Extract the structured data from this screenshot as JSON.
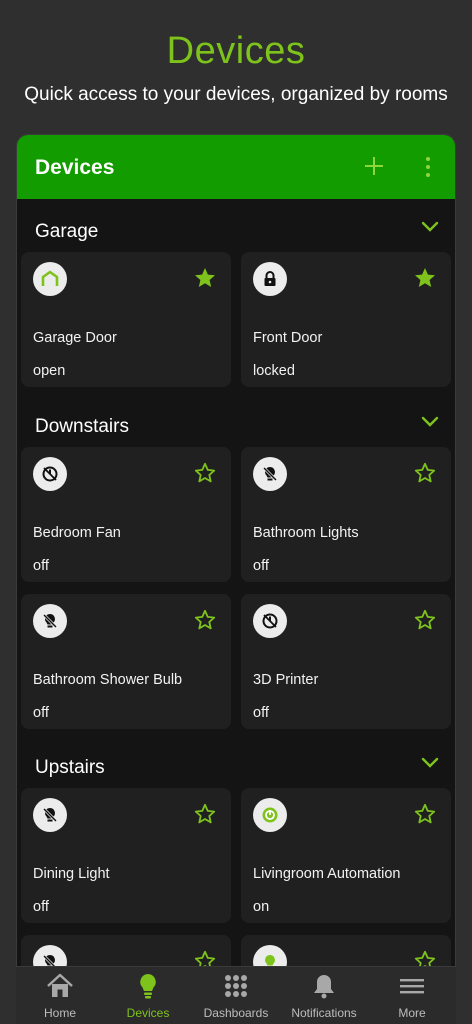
{
  "hero": {
    "title": "Devices",
    "subtitle": "Quick access to your devices, organized by rooms"
  },
  "panel": {
    "title": "Devices",
    "add_icon": "plus-icon",
    "menu_icon": "kebab-menu-icon"
  },
  "colors": {
    "accent": "#7ec31c",
    "header_green": "#139c00",
    "background": "#2f2f2f",
    "panel": "#141414",
    "card": "#202020"
  },
  "rooms": [
    {
      "name": "Garage",
      "devices": [
        {
          "name": "Garage Door",
          "state": "open",
          "icon": "garage-icon",
          "favorite": true
        },
        {
          "name": "Front Door",
          "state": "locked",
          "icon": "lock-icon",
          "favorite": true
        }
      ]
    },
    {
      "name": "Downstairs",
      "devices": [
        {
          "name": "Bedroom Fan",
          "state": "off",
          "icon": "power-off-icon",
          "favorite": false
        },
        {
          "name": "Bathroom Lights",
          "state": "off",
          "icon": "bulb-off-icon",
          "favorite": false
        },
        {
          "name": "Bathroom Shower Bulb",
          "state": "off",
          "icon": "bulb-off-icon",
          "favorite": false
        },
        {
          "name": "3D Printer",
          "state": "off",
          "icon": "power-off-icon",
          "favorite": false
        }
      ]
    },
    {
      "name": "Upstairs",
      "devices": [
        {
          "name": "Dining Light",
          "state": "off",
          "icon": "bulb-off-icon",
          "favorite": false
        },
        {
          "name": "Livingroom Automation",
          "state": "on",
          "icon": "power-on-icon",
          "favorite": false
        },
        {
          "name": "",
          "state": "",
          "icon": "bulb-off-icon",
          "favorite": false
        },
        {
          "name": "",
          "state": "",
          "icon": "bulb-on-icon",
          "favorite": false
        }
      ]
    }
  ],
  "nav": [
    {
      "label": "Home",
      "icon": "home-icon",
      "active": false
    },
    {
      "label": "Devices",
      "icon": "bulb-icon",
      "active": true
    },
    {
      "label": "Dashboards",
      "icon": "grid-icon",
      "active": false
    },
    {
      "label": "Notifications",
      "icon": "bell-icon",
      "active": false
    },
    {
      "label": "More",
      "icon": "menu-icon",
      "active": false
    }
  ]
}
